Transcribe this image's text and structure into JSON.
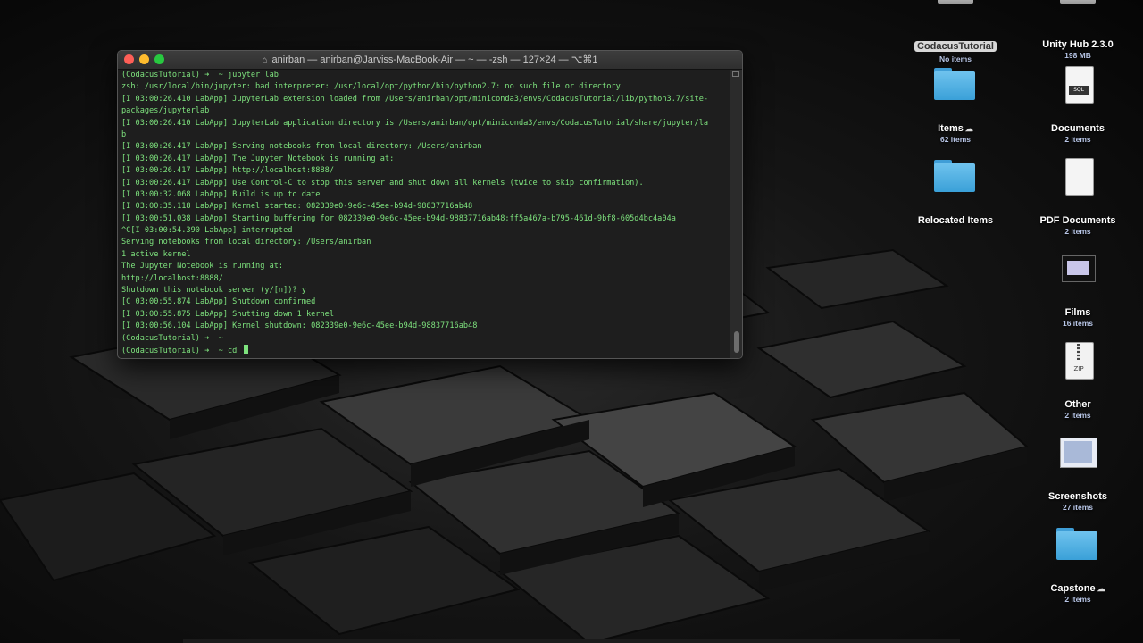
{
  "terminal": {
    "title": "anirban — anirban@Jarviss-MacBook-Air — ~ — -zsh — 127×24 — ⌥⌘1",
    "lines": [
      "(CodacusTutorial) ➜  ~ jupyter lab",
      "zsh: /usr/local/bin/jupyter: bad interpreter: /usr/local/opt/python/bin/python2.7: no such file or directory",
      "[I 03:00:26.410 LabApp] JupyterLab extension loaded from /Users/anirban/opt/miniconda3/envs/CodacusTutorial/lib/python3.7/site-",
      "packages/jupyterlab",
      "[I 03:00:26.410 LabApp] JupyterLab application directory is /Users/anirban/opt/miniconda3/envs/CodacusTutorial/share/jupyter/la",
      "b",
      "[I 03:00:26.417 LabApp] Serving notebooks from local directory: /Users/anirban",
      "[I 03:00:26.417 LabApp] The Jupyter Notebook is running at:",
      "[I 03:00:26.417 LabApp] http://localhost:8888/",
      "[I 03:00:26.417 LabApp] Use Control-C to stop this server and shut down all kernels (twice to skip confirmation).",
      "[I 03:00:32.068 LabApp] Build is up to date",
      "[I 03:00:35.118 LabApp] Kernel started: 082339e0-9e6c-45ee-b94d-98837716ab48",
      "[I 03:00:51.038 LabApp] Starting buffering for 082339e0-9e6c-45ee-b94d-98837716ab48:ff5a467a-b795-461d-9bf8-605d4bc4a04a",
      "^C[I 03:00:54.390 LabApp] interrupted",
      "Serving notebooks from local directory: /Users/anirban",
      "1 active kernel",
      "The Jupyter Notebook is running at:",
      "http://localhost:8888/",
      "Shutdown this notebook server (y/[n])? y",
      "[C 03:00:55.874 LabApp] Shutdown confirmed",
      "[I 03:00:55.875 LabApp] Shutting down 1 kernel",
      "[I 03:00:56.104 LabApp] Kernel shutdown: 082339e0-9e6c-45ee-b94d-98837716ab48",
      "(CodacusTutorial) ➜  ~",
      "(CodacusTutorial) ➜  ~ cd "
    ]
  },
  "desktop": {
    "items": [
      {
        "label": "CodacusTutorial",
        "sub": "No items",
        "icon": "hard-drive-icon",
        "selected": true
      },
      {
        "label": "Unity Hub 2.3.0",
        "sub": "198 MB",
        "icon": "hard-drive-icon"
      },
      {
        "label": "Items",
        "sub": "62 items",
        "icon": "folder-icon",
        "cloud": "☁"
      },
      {
        "label": "Documents",
        "sub": "2 items",
        "icon": "sql-document-icon",
        "tag": "SQL"
      },
      {
        "label": "Relocated Items",
        "sub": "",
        "icon": "folder-icon"
      },
      {
        "label": "PDF Documents",
        "sub": "2 items",
        "icon": "document-icon"
      },
      {
        "label": "Films",
        "sub": "16 items",
        "icon": "film-icon"
      },
      {
        "label": "Other",
        "sub": "2 items",
        "icon": "zip-icon",
        "tag": "ZIP"
      },
      {
        "label": "Screenshots",
        "sub": "27 items",
        "icon": "screenshot-icon"
      },
      {
        "label": "Capstone",
        "sub": "2 items",
        "icon": "folder-icon",
        "cloud": "☁"
      }
    ]
  },
  "colors": {
    "terminal_text": "#7ee37e",
    "terminal_bg": "#1e1e1e",
    "folder": "#4fb0e4"
  }
}
